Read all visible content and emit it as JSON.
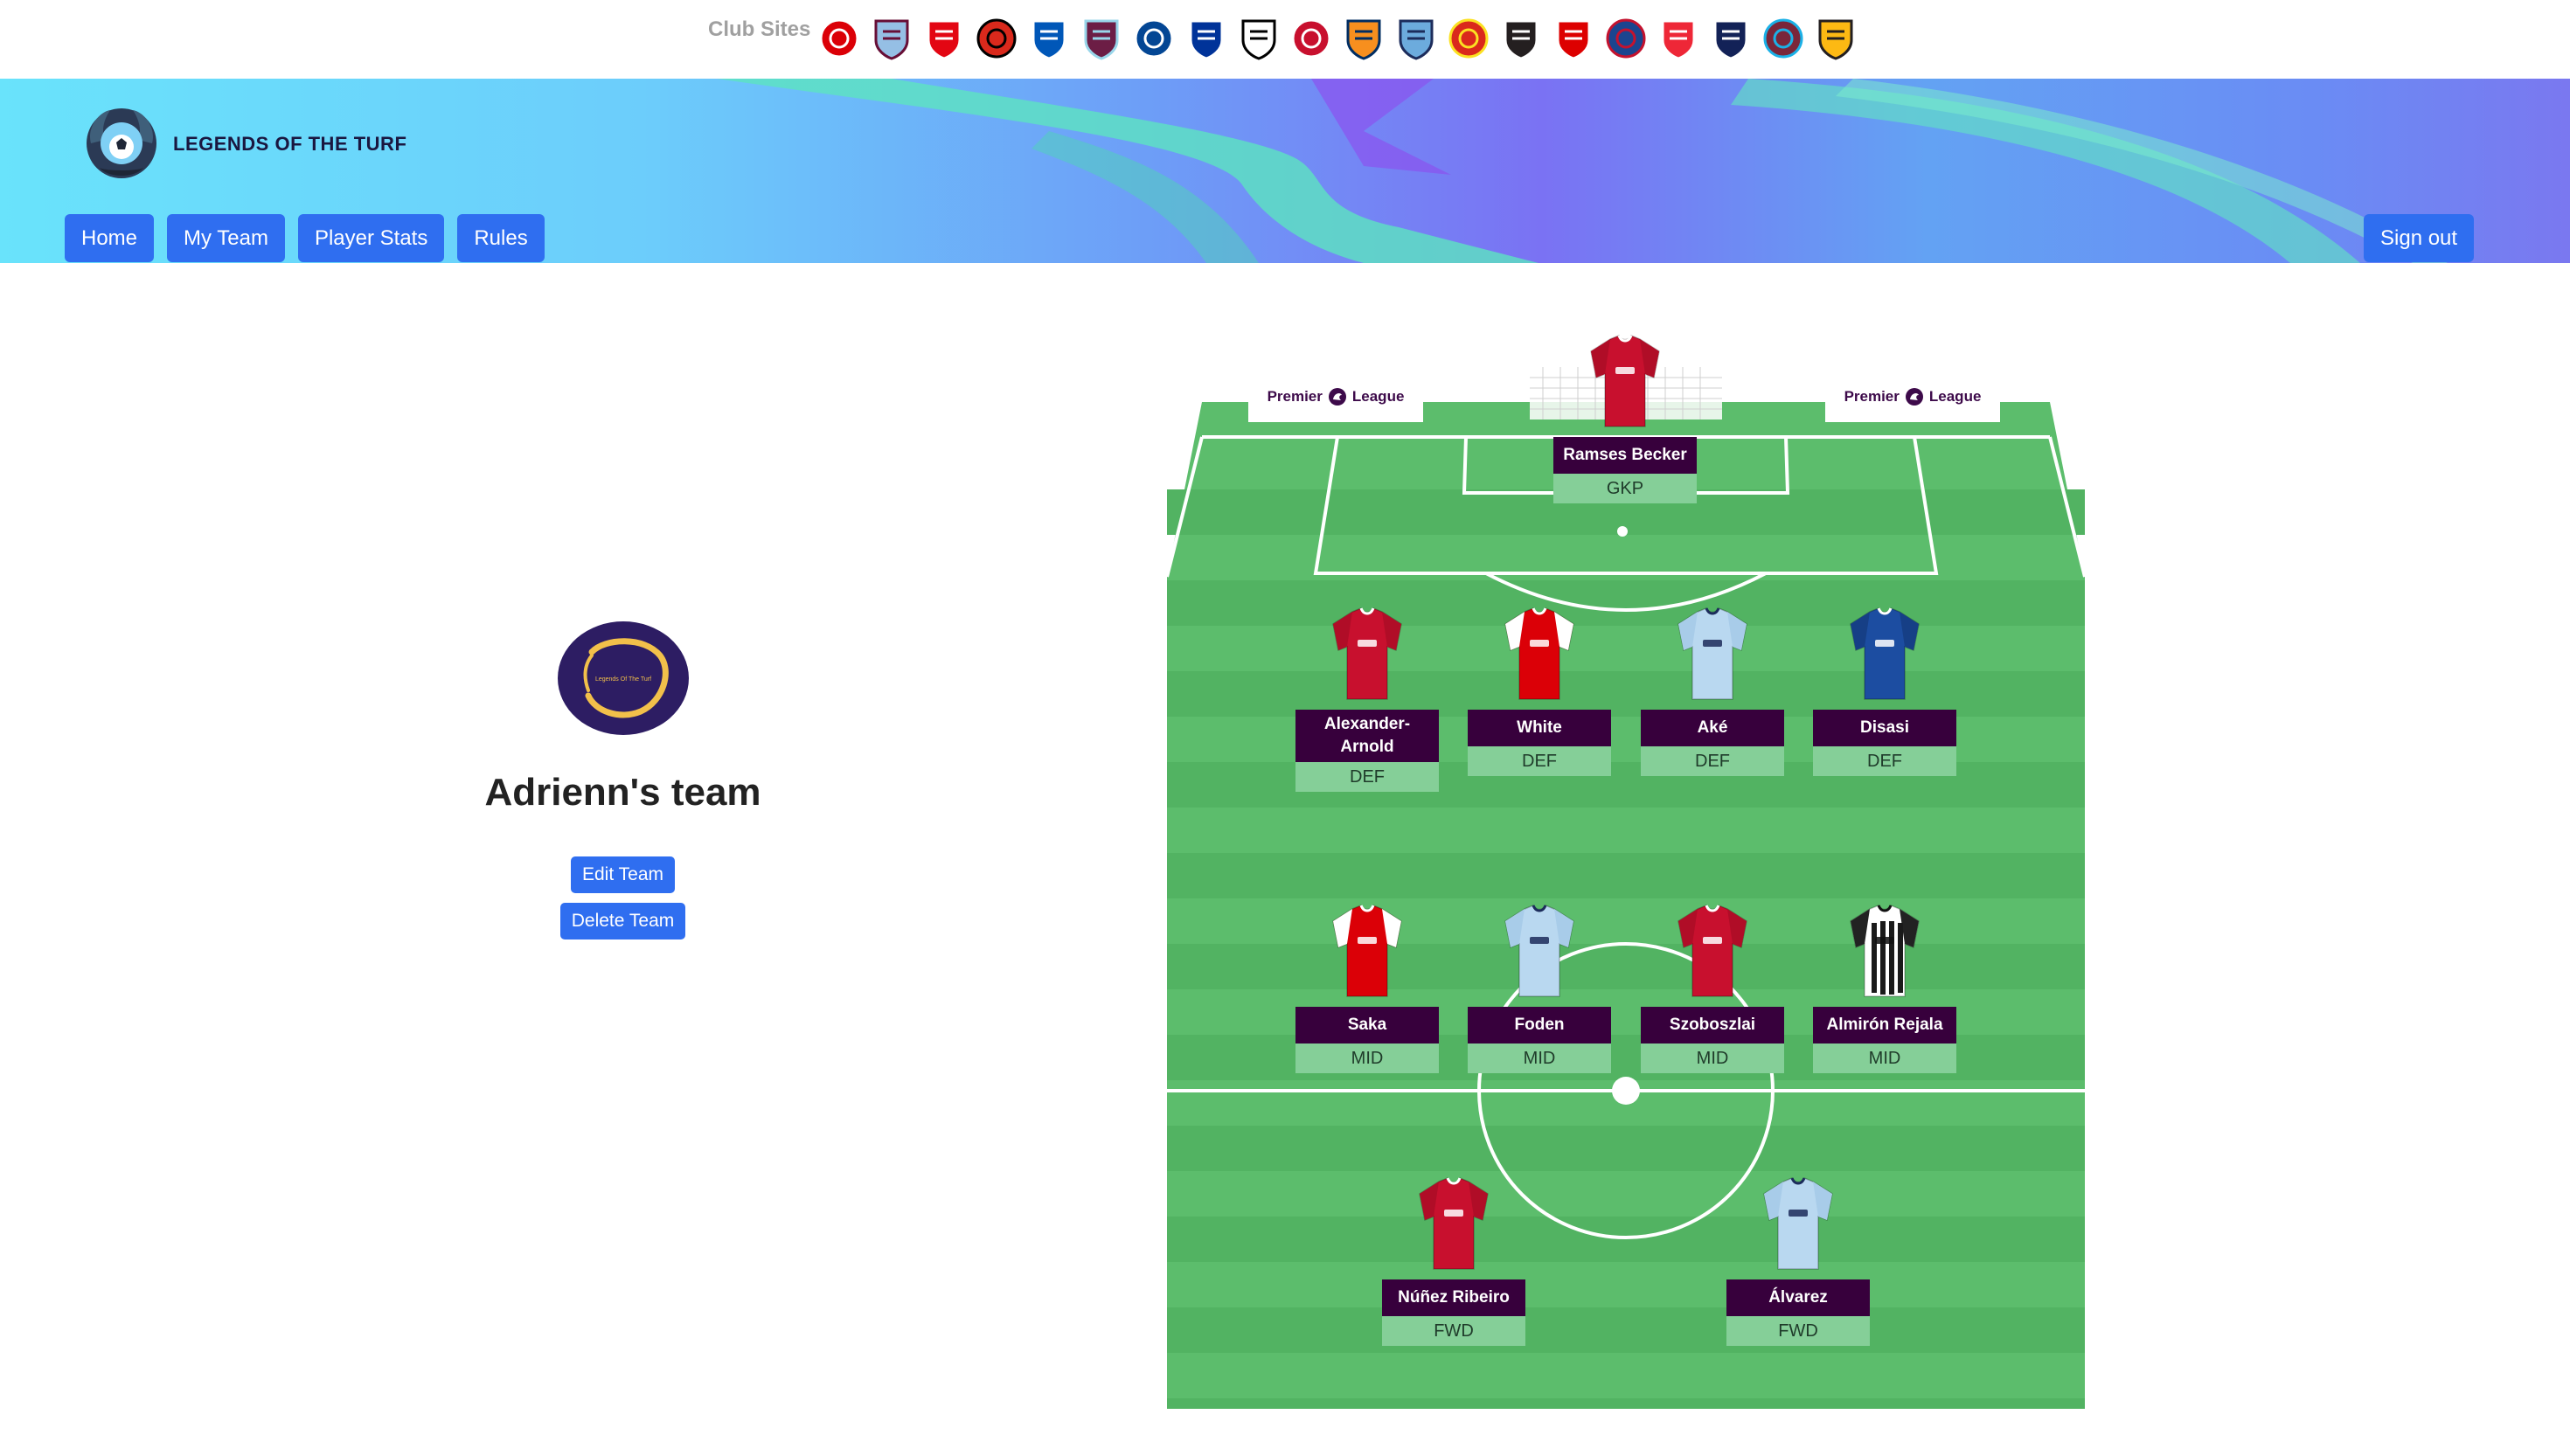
{
  "club_sites": {
    "title": "Club Sites",
    "crests": [
      {
        "icon": "arsenal-crest-icon",
        "color": "#db0007",
        "accent": "#ffffff"
      },
      {
        "icon": "aston-villa-crest-icon",
        "color": "#95bfe5",
        "accent": "#670e36"
      },
      {
        "icon": "brentford-crest-icon",
        "color": "#e30613",
        "accent": "#ffffff"
      },
      {
        "icon": "bournemouth-crest-icon",
        "color": "#da291c",
        "accent": "#000000"
      },
      {
        "icon": "brighton-crest-icon",
        "color": "#0057b8",
        "accent": "#ffffff"
      },
      {
        "icon": "burnley-crest-icon",
        "color": "#6c1d45",
        "accent": "#99d6ea"
      },
      {
        "icon": "chelsea-crest-icon",
        "color": "#034694",
        "accent": "#ffffff"
      },
      {
        "icon": "everton-crest-icon",
        "color": "#003399",
        "accent": "#ffffff"
      },
      {
        "icon": "fulham-crest-icon",
        "color": "#ffffff",
        "accent": "#000000"
      },
      {
        "icon": "liverpool-crest-icon",
        "color": "#c8102e",
        "accent": "#ffffff"
      },
      {
        "icon": "luton-crest-icon",
        "color": "#f78f1e",
        "accent": "#002d62"
      },
      {
        "icon": "man-city-crest-icon",
        "color": "#6cabdd",
        "accent": "#1c2c5b"
      },
      {
        "icon": "man-united-crest-icon",
        "color": "#da291c",
        "accent": "#fbe122"
      },
      {
        "icon": "newcastle-crest-icon",
        "color": "#241f20",
        "accent": "#ffffff"
      },
      {
        "icon": "nottingham-forest-crest-icon",
        "color": "#dd0000",
        "accent": "#ffffff"
      },
      {
        "icon": "crystal-palace-crest-icon",
        "color": "#1b458f",
        "accent": "#c4122e"
      },
      {
        "icon": "sheffield-united-crest-icon",
        "color": "#ee2737",
        "accent": "#ffffff"
      },
      {
        "icon": "tottenham-crest-icon",
        "color": "#132257",
        "accent": "#ffffff"
      },
      {
        "icon": "west-ham-crest-icon",
        "color": "#7a263a",
        "accent": "#1bb1e7"
      },
      {
        "icon": "wolves-crest-icon",
        "color": "#fdb913",
        "accent": "#231f20"
      }
    ]
  },
  "header": {
    "brand_name": "LEGENDS OF THE TURF",
    "nav": [
      "Home",
      "My Team",
      "Player Stats",
      "Rules"
    ],
    "sign_out": "Sign out"
  },
  "team": {
    "badge_text": "Legends Of The Turf",
    "title": "Adrienn's team",
    "edit_label": "Edit Team",
    "delete_label": "Delete Team"
  },
  "pitch": {
    "board_left_a": "Premier",
    "board_left_b": "League",
    "board_right_a": "Premier",
    "board_right_b": "League",
    "goalkeeper": {
      "name": "Ramses Becker",
      "position": "GKP",
      "kit": "liverpool"
    },
    "defenders": [
      {
        "name": "Alexander-Arnold",
        "position": "DEF",
        "kit": "liverpool"
      },
      {
        "name": "White",
        "position": "DEF",
        "kit": "arsenal"
      },
      {
        "name": "Aké",
        "position": "DEF",
        "kit": "mancity"
      },
      {
        "name": "Disasi",
        "position": "DEF",
        "kit": "chelsea"
      }
    ],
    "midfielders": [
      {
        "name": "Saka",
        "position": "MID",
        "kit": "arsenal"
      },
      {
        "name": "Foden",
        "position": "MID",
        "kit": "mancity"
      },
      {
        "name": "Szoboszlai",
        "position": "MID",
        "kit": "liverpool"
      },
      {
        "name": "Almirón Rejala",
        "position": "MID",
        "kit": "newcastle"
      }
    ],
    "forwards": [
      {
        "name": "Núñez Ribeiro",
        "position": "FWD",
        "kit": "liverpool"
      },
      {
        "name": "Álvarez",
        "position": "FWD",
        "kit": "mancity"
      }
    ],
    "colors": {
      "grass_light": "#5cbd6c",
      "grass_dark": "#52b362",
      "name_bg": "#37003c",
      "pos_bg": "#85cf98"
    }
  }
}
